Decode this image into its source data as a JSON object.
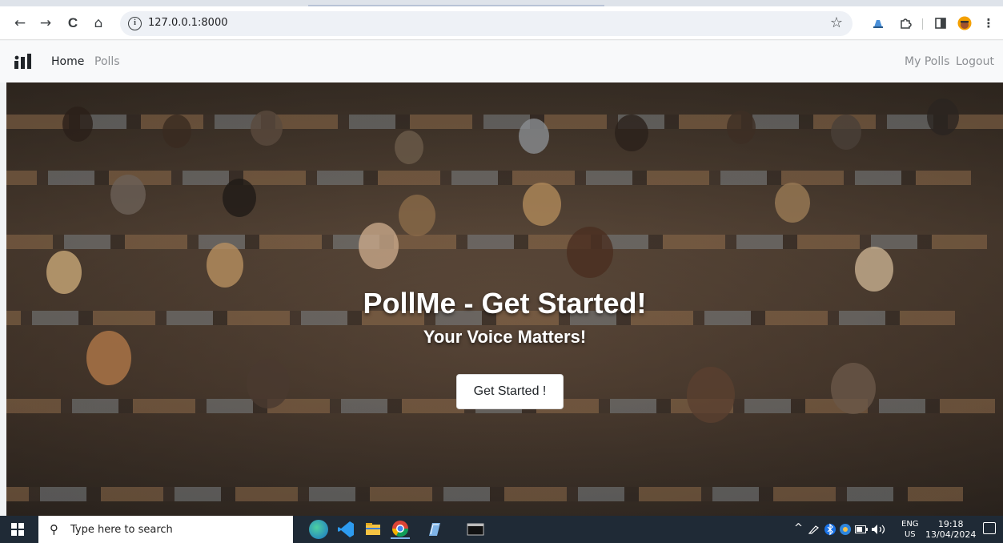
{
  "browser": {
    "url": "127.0.0.1:8000",
    "nav": {
      "back": "←",
      "forward": "→",
      "reload": "C",
      "home": "⌂",
      "info": "i",
      "bookmark": "☆"
    },
    "extensions": [
      "extension-icon",
      "puzzle-icon",
      "sidebar-icon",
      "profile-icon",
      "menu-icon"
    ]
  },
  "site": {
    "logo": "logo-icon",
    "nav_left": [
      {
        "label": "Home",
        "active": true
      },
      {
        "label": "Polls",
        "active": false
      }
    ],
    "nav_right": [
      {
        "label": "My Polls"
      },
      {
        "label": "Logout"
      }
    ]
  },
  "hero": {
    "title": "PollMe - Get Started!",
    "subtitle": "Your Voice Matters!",
    "cta_label": "Get Started !"
  },
  "taskbar": {
    "search_placeholder": "Type here to search",
    "apps": [
      "edge-icon",
      "vscode-icon",
      "file-explorer-icon",
      "chrome-icon",
      "notes-icon",
      "terminal-icon"
    ],
    "tray": {
      "chevron": "^",
      "lang_top": "ENG",
      "lang_bottom": "US",
      "time": "19:18",
      "date": "13/04/2024"
    }
  },
  "colors": {
    "navbar_bg": "#f8f9fa",
    "taskbar_bg": "#1f2a36",
    "hero_text": "#ffffff"
  }
}
